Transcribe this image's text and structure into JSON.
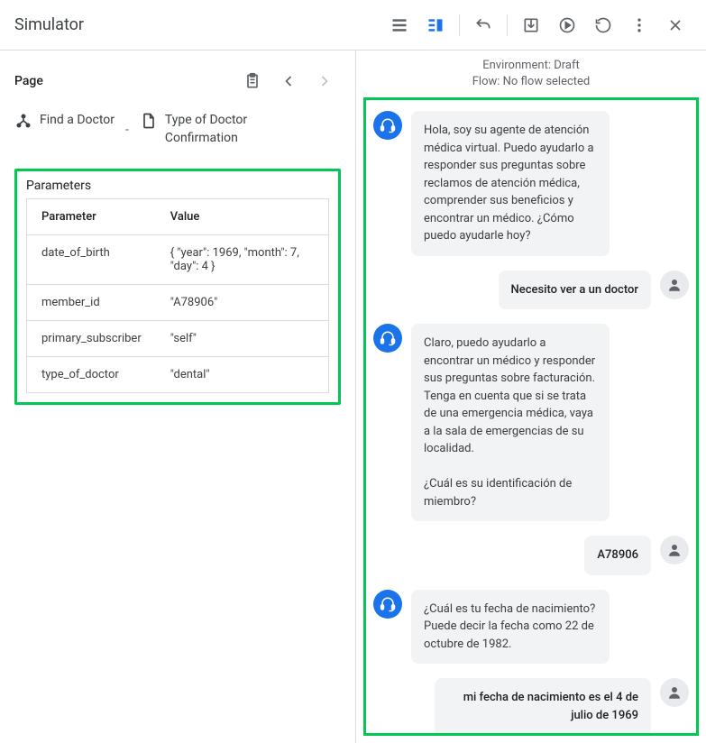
{
  "header": {
    "title": "Simulator"
  },
  "page_section": {
    "label": "Page",
    "breadcrumb": [
      {
        "icon": "flow",
        "text": "Find a Doctor"
      },
      {
        "icon": "page",
        "text": "Type of Doctor Confirmation"
      }
    ],
    "separator": "-"
  },
  "parameters": {
    "title": "Parameters",
    "headers": {
      "param": "Parameter",
      "value": "Value"
    },
    "rows": [
      {
        "param": "date_of_birth",
        "value": "{ \"year\": 1969, \"month\": 7, \"day\": 4 }"
      },
      {
        "param": "member_id",
        "value": "\"A78906\""
      },
      {
        "param": "primary_subscriber",
        "value": "\"self\""
      },
      {
        "param": "type_of_doctor",
        "value": "\"dental\""
      }
    ]
  },
  "environment": {
    "env_line": "Environment: Draft",
    "flow_line": "Flow: No flow selected"
  },
  "chat": [
    {
      "role": "agent",
      "text": "Hola, soy su agente de atención médica virtual. Puedo ayudarlo a responder sus preguntas sobre reclamos de atención médica, comprender sus beneficios y encontrar un médico. ¿Cómo puedo ayudarle hoy?"
    },
    {
      "role": "user",
      "text": "Necesito ver a un doctor"
    },
    {
      "role": "agent",
      "text": "Claro, puedo ayudarlo a encontrar un médico y responder sus preguntas sobre facturación. Tenga en cuenta que si se trata de una emergencia médica, vaya a la sala de emergencias de su localidad.\n\n¿Cuál es su identificación de miembro?"
    },
    {
      "role": "user",
      "text": "A78906"
    },
    {
      "role": "agent",
      "text": "¿Cuál es tu fecha de nacimiento? Puede decir la fecha como 22 de octubre de 1982."
    },
    {
      "role": "user",
      "text": "mi fecha de nacimiento es el 4 de julio de 1969"
    }
  ]
}
